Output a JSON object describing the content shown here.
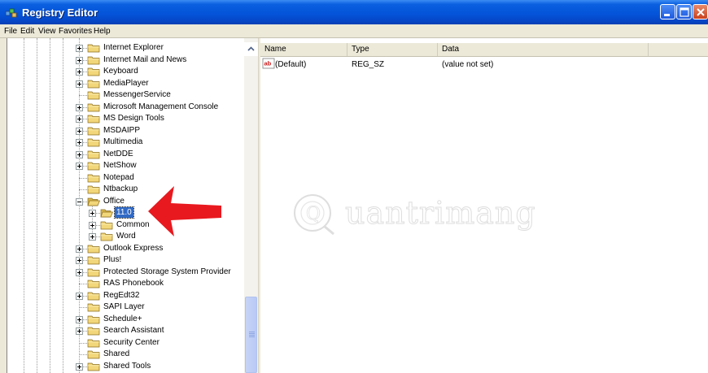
{
  "window": {
    "title": "Registry Editor"
  },
  "menu": [
    "File",
    "Edit",
    "View",
    "Favorites",
    "Help"
  ],
  "tree": {
    "items": [
      {
        "label": "Internet Explorer",
        "level": 0,
        "expander": "plus"
      },
      {
        "label": "Internet Mail and News",
        "level": 0,
        "expander": "plus"
      },
      {
        "label": "Keyboard",
        "level": 0,
        "expander": "plus"
      },
      {
        "label": "MediaPlayer",
        "level": 0,
        "expander": "plus"
      },
      {
        "label": "MessengerService",
        "level": 0,
        "expander": "none"
      },
      {
        "label": "Microsoft Management Console",
        "level": 0,
        "expander": "plus"
      },
      {
        "label": "MS Design Tools",
        "level": 0,
        "expander": "plus"
      },
      {
        "label": "MSDAIPP",
        "level": 0,
        "expander": "plus"
      },
      {
        "label": "Multimedia",
        "level": 0,
        "expander": "plus"
      },
      {
        "label": "NetDDE",
        "level": 0,
        "expander": "plus"
      },
      {
        "label": "NetShow",
        "level": 0,
        "expander": "plus"
      },
      {
        "label": "Notepad",
        "level": 0,
        "expander": "none"
      },
      {
        "label": "Ntbackup",
        "level": 0,
        "expander": "none"
      },
      {
        "label": "Office",
        "level": 0,
        "expander": "minus"
      },
      {
        "label": "11.0",
        "level": 1,
        "expander": "plus",
        "selected": true
      },
      {
        "label": "Common",
        "level": 1,
        "expander": "plus"
      },
      {
        "label": "Word",
        "level": 1,
        "expander": "plus"
      },
      {
        "label": "Outlook Express",
        "level": 0,
        "expander": "plus"
      },
      {
        "label": "Plus!",
        "level": 0,
        "expander": "plus"
      },
      {
        "label": "Protected Storage System Provider",
        "level": 0,
        "expander": "plus"
      },
      {
        "label": "RAS Phonebook",
        "level": 0,
        "expander": "none"
      },
      {
        "label": "RegEdt32",
        "level": 0,
        "expander": "plus"
      },
      {
        "label": "SAPI Layer",
        "level": 0,
        "expander": "none"
      },
      {
        "label": "Schedule+",
        "level": 0,
        "expander": "plus"
      },
      {
        "label": "Search Assistant",
        "level": 0,
        "expander": "plus"
      },
      {
        "label": "Security Center",
        "level": 0,
        "expander": "none"
      },
      {
        "label": "Shared",
        "level": 0,
        "expander": "none"
      },
      {
        "label": "Shared Tools",
        "level": 0,
        "expander": "plus"
      }
    ]
  },
  "list": {
    "columns": [
      "Name",
      "Type",
      "Data"
    ],
    "rows": [
      {
        "name": "(Default)",
        "type": "REG_SZ",
        "data": "(value not set)",
        "icon": "string-value-icon"
      }
    ]
  },
  "watermark": {
    "text": "uantrimang",
    "logo_letter": "Q"
  },
  "colors": {
    "titlebar": "#0453d8",
    "selection": "#316ac5",
    "folder": "#f2d67a",
    "annotation_arrow": "#e8191f"
  },
  "icons": {
    "app": "registry-editor-icon",
    "minimize": "minimize-icon",
    "maximize": "maximize-icon",
    "close": "close-icon",
    "folder": "folder-icon",
    "annotation": "red-arrow-icon"
  }
}
